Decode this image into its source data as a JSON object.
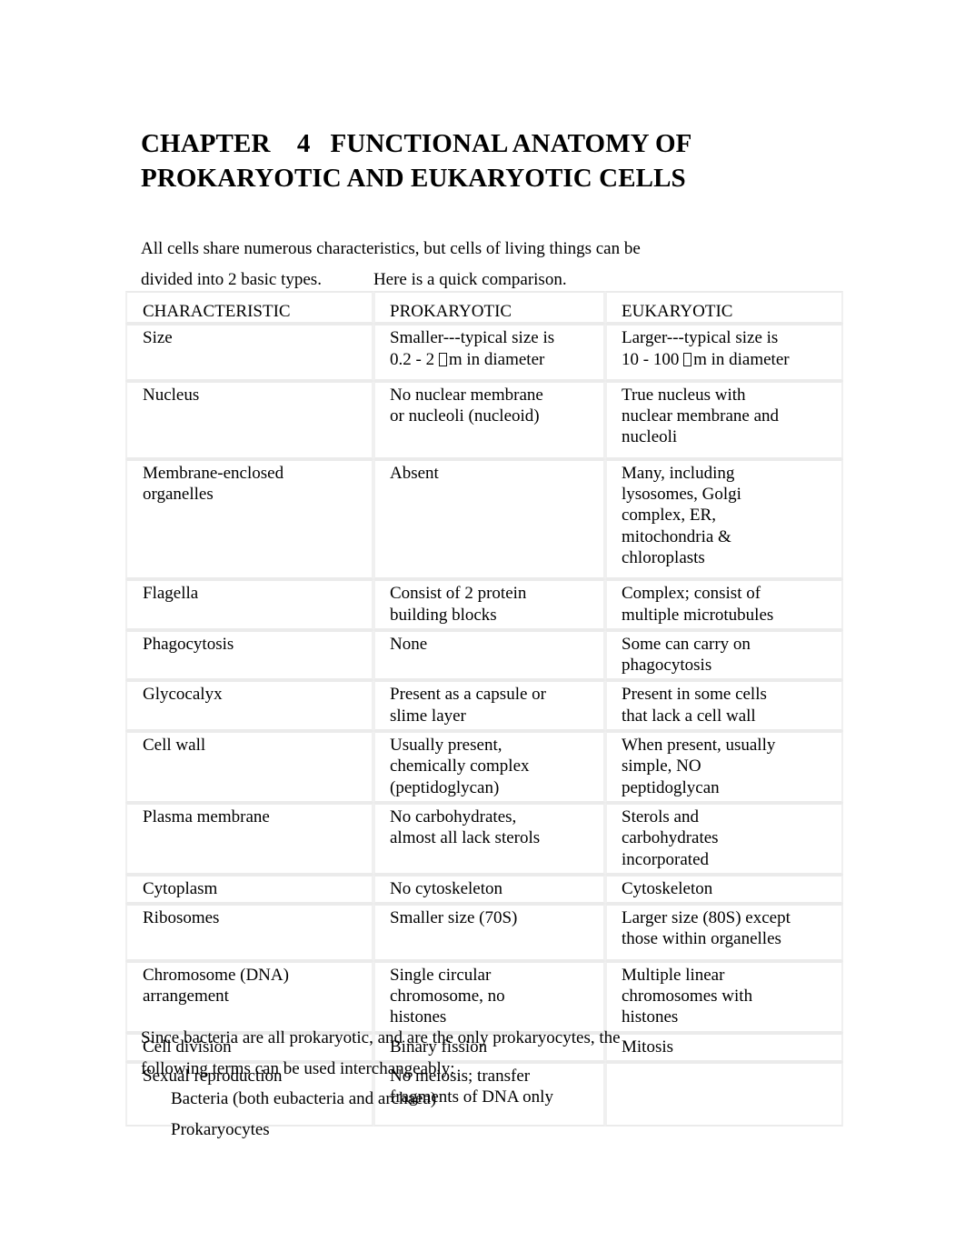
{
  "document": {
    "title_line1": "CHAPTER    4   FUNCTIONAL ANATOMY OF",
    "title_line2": "PROKARYOTIC AND EUKARYOTIC CELLS",
    "intro_line1": "All cells share numerous characteristics, but cells of living things can be",
    "intro_line2": "divided into 2 basic types.            Here is a quick comparison.",
    "closing_line1": "Since bacteria are all prokaryotic, and are the only prokaryocytes, the",
    "closing_line2": "following terms can be used interchangeably:",
    "closing_item1": "Bacteria (both eubacteria and archaea)",
    "closing_item2": "Prokaryocytes"
  },
  "table": {
    "headers": [
      "CHARACTERISTIC",
      "PROKARYOTIC",
      "EUKARYOTIC"
    ],
    "rows": [
      {
        "characteristic": "Size",
        "prokaryotic_a": "Smaller---typical size is\n0.2 - 2   ",
        "prokaryotic_b": "m in diameter",
        "eukaryotic_a": "Larger---typical size is\n10 - 100    ",
        "eukaryotic_b": "m in diameter"
      },
      {
        "characteristic": "Nucleus",
        "prokaryotic": "No nuclear membrane\nor nucleoli (nucleoid)",
        "eukaryotic": "True nucleus with\nnuclear membrane and\nnucleoli"
      },
      {
        "characteristic": "Membrane-enclosed\norganelles",
        "prokaryotic": "Absent",
        "eukaryotic": "Many, including\nlysosomes, Golgi\ncomplex, ER,\nmitochondria &\nchloroplasts"
      },
      {
        "characteristic": "Flagella",
        "prokaryotic": "Consist of 2 protein\nbuilding blocks",
        "eukaryotic": "Complex; consist of\nmultiple microtubules"
      },
      {
        "characteristic": "Phagocytosis",
        "prokaryotic": "None",
        "eukaryotic": "Some can carry on\nphagocytosis"
      },
      {
        "characteristic": "Glycocalyx",
        "prokaryotic": "Present as a capsule or\nslime layer",
        "eukaryotic": "Present in some cells\nthat lack a cell wall"
      },
      {
        "characteristic": "Cell wall",
        "prokaryotic": "Usually present,\nchemically complex\n(peptidoglycan)",
        "eukaryotic": "When present, usually\nsimple, NO\npeptidoglycan"
      },
      {
        "characteristic": "Plasma membrane",
        "prokaryotic": "No carbohydrates,\nalmost all lack sterols",
        "eukaryotic": "Sterols and\ncarbohydrates\nincorporated"
      },
      {
        "characteristic": "Cytoplasm",
        "prokaryotic": "No cytoskeleton",
        "eukaryotic": "Cytoskeleton"
      },
      {
        "characteristic": "Ribosomes",
        "prokaryotic": "Smaller size (70S)",
        "eukaryotic": "Larger size (80S) except\nthose within organelles"
      },
      {
        "characteristic": "Chromosome (DNA)\narrangement",
        "prokaryotic": "Single circular\nchromosome, no\nhistones",
        "eukaryotic": "Multiple linear\nchromosomes with\nhistones"
      },
      {
        "characteristic": "Cell division",
        "prokaryotic": "Binary fission",
        "eukaryotic": "Mitosis"
      },
      {
        "characteristic": "Sexual reproduction",
        "prokaryotic": "No meiosis; transfer\nfragments of DNA only",
        "eukaryotic": ""
      }
    ]
  },
  "colors": {
    "page_background": "#ffffff",
    "text": "#000000",
    "table_cell_background": "#ffffff",
    "table_border": "#f0f0f0"
  }
}
